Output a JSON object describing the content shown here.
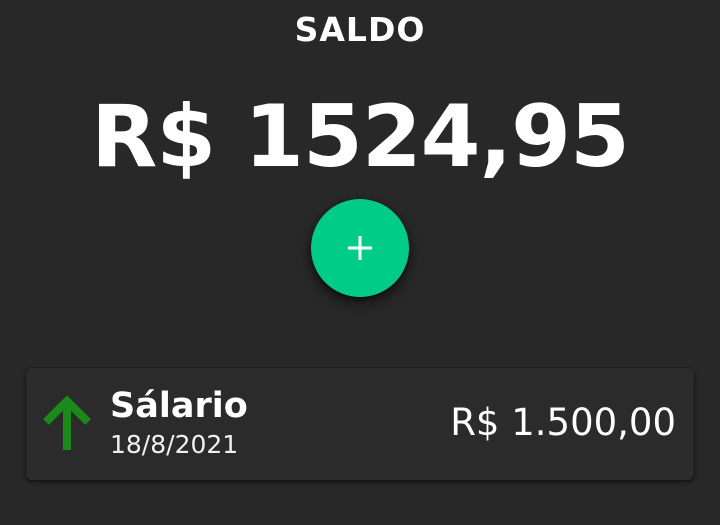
{
  "balance": {
    "title": "SALDO",
    "amount": "R$ 1524,95"
  },
  "add_button": {
    "icon": "plus-icon",
    "color": "#00cc88"
  },
  "transactions": [
    {
      "type": "income",
      "icon": "arrow-up-icon",
      "icon_color": "#1a8a1a",
      "description": "Sálario",
      "date": "18/8/2021",
      "value": "R$ 1.500,00"
    }
  ],
  "colors": {
    "background": "#282828",
    "card": "#2b2b2b",
    "text": "#ffffff"
  }
}
